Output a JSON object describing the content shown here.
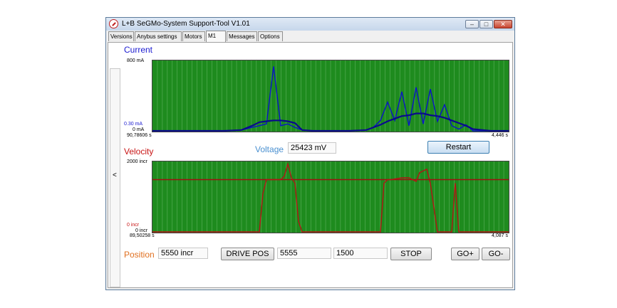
{
  "window": {
    "title": "L+B SeGMo-System Support-Tool V1.01",
    "controls": {
      "minimize": "–",
      "maximize": "□",
      "close": "✕"
    },
    "icon": "app-logo-icon"
  },
  "tabs": [
    {
      "label": "Versions"
    },
    {
      "label": "Anybus settings"
    },
    {
      "label": "Motors"
    },
    {
      "label": "M1",
      "active": true
    },
    {
      "label": "Messages"
    },
    {
      "label": "Options"
    }
  ],
  "collapse_label": "<",
  "current_panel": {
    "heading": "Current",
    "heading_color": "#1a1ad0",
    "y_max_label": "800 mA",
    "y_marker_label": "0.30 mA",
    "y_min_label": "0 mA",
    "x_start_label": "90,78606 s",
    "x_end_label": "4,446 s",
    "chart_data": {
      "type": "line",
      "ylim": [
        0,
        800
      ],
      "x": [
        0,
        0.05,
        0.1,
        0.15,
        0.2,
        0.25,
        0.28,
        0.3,
        0.32,
        0.34,
        0.36,
        0.38,
        0.4,
        0.42,
        0.45,
        0.5,
        0.55,
        0.6,
        0.62,
        0.64,
        0.66,
        0.68,
        0.7,
        0.72,
        0.74,
        0.76,
        0.78,
        0.8,
        0.82,
        0.84,
        0.86,
        0.88,
        0.9,
        0.95,
        1.0
      ],
      "series": [
        {
          "color": "#0a14c8",
          "values": [
            0,
            0,
            0,
            0,
            0,
            10,
            40,
            60,
            80,
            740,
            60,
            80,
            40,
            10,
            0,
            0,
            0,
            10,
            40,
            120,
            330,
            120,
            450,
            60,
            500,
            80,
            480,
            110,
            300,
            60,
            20,
            70,
            0,
            0,
            0
          ]
        },
        {
          "color": "#0a0a8c",
          "values": [
            0,
            0,
            0,
            0,
            0,
            10,
            60,
            100,
            110,
            120,
            120,
            110,
            90,
            10,
            0,
            0,
            0,
            10,
            40,
            70,
            110,
            140,
            170,
            180,
            200,
            200,
            180,
            170,
            150,
            120,
            90,
            60,
            20,
            0,
            0
          ]
        }
      ]
    }
  },
  "voltage": {
    "label": "Voltage",
    "value": "25423 mV"
  },
  "restart_label": "Restart",
  "velocity_panel": {
    "heading": "Velocity",
    "heading_color": "#c81414",
    "y_max_label": "2000 incr",
    "y_marker_label": "0 incr",
    "y_min_label": "0 incr",
    "x_start_label": "89,50258 s",
    "x_end_label": "4,087 s",
    "chart_data": {
      "type": "line",
      "ylim": [
        0,
        2000
      ],
      "reference_line": 1500,
      "x": [
        0,
        0.2,
        0.3,
        0.31,
        0.32,
        0.33,
        0.36,
        0.37,
        0.38,
        0.39,
        0.4,
        0.41,
        0.42,
        0.5,
        0.64,
        0.65,
        0.66,
        0.67,
        0.7,
        0.72,
        0.74,
        0.75,
        0.76,
        0.77,
        0.78,
        0.8,
        0.83,
        0.84,
        0.85,
        0.86,
        1.0
      ],
      "series": [
        {
          "color": "#b41414",
          "values": [
            0,
            0,
            0,
            1100,
            1500,
            1500,
            1500,
            1600,
            1950,
            1550,
            1400,
            300,
            0,
            0,
            0,
            1400,
            1500,
            1500,
            1550,
            1550,
            1450,
            1700,
            1750,
            1800,
            1400,
            0,
            0,
            0,
            1400,
            0,
            0
          ]
        }
      ]
    }
  },
  "position": {
    "label": "Position",
    "label_color": "#e07020",
    "value": "5550 incr",
    "drive_pos_label": "DRIVE POS",
    "target_value": "5555",
    "speed_value": "1500",
    "stop_label": "STOP",
    "go_plus_label": "GO+",
    "go_minus_label": "GO-"
  }
}
